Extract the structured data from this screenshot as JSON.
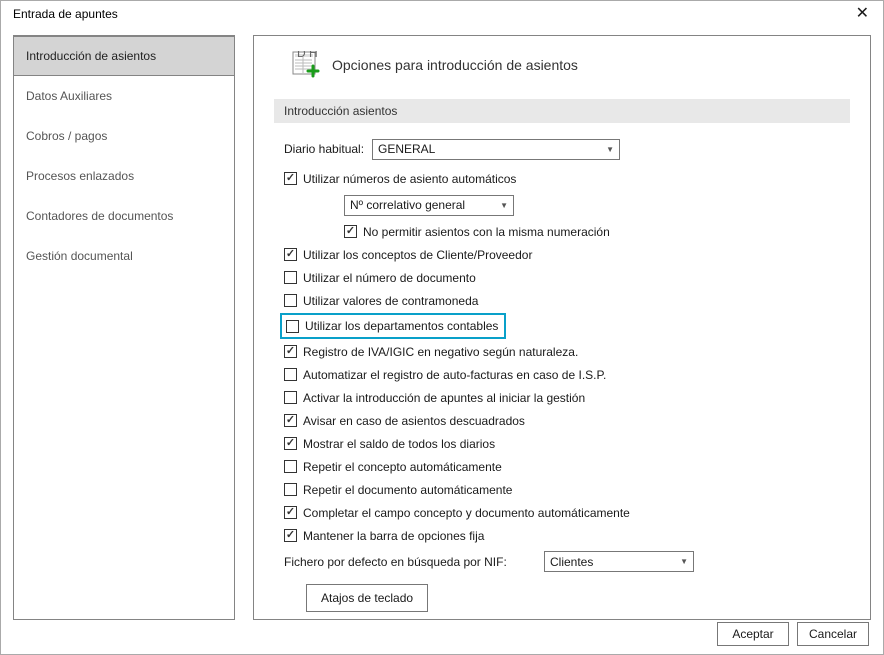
{
  "window": {
    "title": "Entrada de apuntes"
  },
  "sidebar": {
    "items": [
      {
        "label": "Introducción de asientos",
        "active": true
      },
      {
        "label": "Datos Auxiliares",
        "active": false
      },
      {
        "label": "Cobros / pagos",
        "active": false
      },
      {
        "label": "Procesos enlazados",
        "active": false
      },
      {
        "label": "Contadores de documentos",
        "active": false
      },
      {
        "label": "Gestión documental",
        "active": false
      }
    ]
  },
  "header": {
    "title": "Opciones para introducción de asientos"
  },
  "section": {
    "title": "Introducción asientos"
  },
  "diario": {
    "label": "Diario habitual:",
    "value": "GENERAL"
  },
  "correlativo": {
    "value": "Nº correlativo general"
  },
  "opts": {
    "auto_num": "Utilizar números de asiento automáticos",
    "no_dup": "No permitir asientos con la misma numeración",
    "conceptos_cp": "Utilizar los conceptos de Cliente/Proveedor",
    "num_doc": "Utilizar el número de documento",
    "contramoneda": "Utilizar valores de contramoneda",
    "departamentos": "Utilizar los departamentos contables",
    "iva_neg": "Registro de IVA/IGIC en negativo según naturaleza.",
    "auto_isp": "Automatizar el registro de auto-facturas en caso de I.S.P.",
    "activar_intro": "Activar la introducción de apuntes al iniciar la gestión",
    "avisar_desc": "Avisar en caso de asientos descuadrados",
    "saldo_diarios": "Mostrar el saldo de todos los diarios",
    "rep_concepto": "Repetir el concepto automáticamente",
    "rep_doc": "Repetir el documento automáticamente",
    "completar_auto": "Completar el campo concepto y documento automáticamente",
    "barra_fija": "Mantener la barra de opciones fija"
  },
  "nif": {
    "label": "Fichero por defecto en búsqueda por NIF:",
    "value": "Clientes"
  },
  "btn_shortcuts": "Atajos de teclado",
  "btn_accept": "Aceptar",
  "btn_cancel": "Cancelar"
}
